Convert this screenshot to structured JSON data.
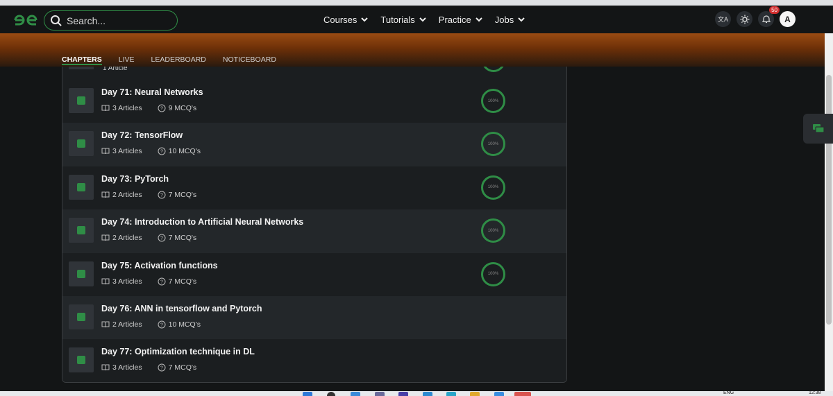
{
  "header": {
    "search_placeholder": "Search...",
    "menu": [
      {
        "label": "Courses"
      },
      {
        "label": "Tutorials"
      },
      {
        "label": "Practice"
      },
      {
        "label": "Jobs"
      }
    ],
    "notifications_count": "50",
    "avatar_letter": "A"
  },
  "tabs": [
    {
      "label": "CHAPTERS",
      "active": true
    },
    {
      "label": "LIVE"
    },
    {
      "label": "LEADERBOARD"
    },
    {
      "label": "NOTICEBOARD"
    }
  ],
  "partial_row": {
    "meta": "1 Article"
  },
  "chapters": [
    {
      "title": "Day 71: Neural Networks",
      "articles": "3 Articles",
      "mcqs": "9 MCQ's",
      "progress": "100%"
    },
    {
      "title": "Day 72: TensorFlow",
      "articles": "3 Articles",
      "mcqs": "10 MCQ's",
      "progress": "100%"
    },
    {
      "title": "Day 73: PyTorch",
      "articles": "2 Articles",
      "mcqs": "7 MCQ's",
      "progress": "100%"
    },
    {
      "title": "Day 74: Introduction to Artificial Neural Networks",
      "articles": "2 Articles",
      "mcqs": "7 MCQ's",
      "progress": "100%"
    },
    {
      "title": "Day 75: Activation functions",
      "articles": "3 Articles",
      "mcqs": "7 MCQ's",
      "progress": "100%"
    },
    {
      "title": "Day 76: ANN in tensorflow and Pytorch",
      "articles": "2 Articles",
      "mcqs": "10 MCQ's",
      "progress": null
    },
    {
      "title": "Day 77: Optimization technique in DL",
      "articles": "3 Articles",
      "mcqs": "7 MCQ's",
      "progress": null
    }
  ],
  "taskbar": {
    "lang": "ENG",
    "time": "12:38"
  },
  "colors": {
    "accent": "#2f8d46",
    "background": "#131516",
    "row_dark": "#1b1e20",
    "row_light": "#23272a"
  }
}
